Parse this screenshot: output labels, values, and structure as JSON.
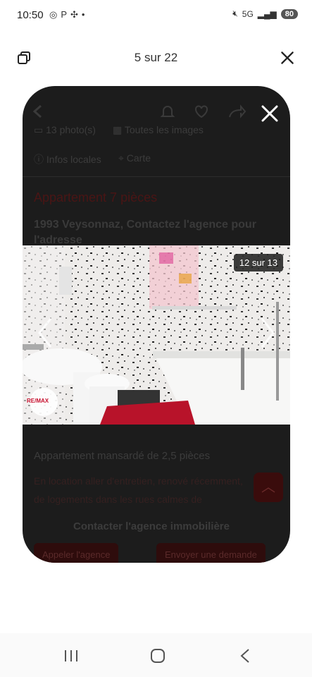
{
  "status_bar": {
    "time": "10:50",
    "left_icons": [
      "whatsapp-icon",
      "parking-icon",
      "fan-icon",
      "dot-icon"
    ],
    "network": "5G",
    "battery": "80"
  },
  "header": {
    "counter": "5 sur 22"
  },
  "listing_background": {
    "photo_count_label": "13 photo(s)",
    "all_images_label": "Toutes les images",
    "local_info_label": "Infos locales",
    "map_label": "Carte",
    "title": "Appartement 7 pièces",
    "address_line1": "1993 Veysonnaz, Contactez l'agence pour",
    "address_line2": "l'adresse",
    "similar_title": "Appartement mansardé de 2,5 pièces",
    "similar_desc_line1": "En location aller d'entretien, renové récemment,",
    "similar_desc_line2": "de logements dans les rues calmes de",
    "contact_heading": "Contacter l'agence immobilière",
    "call_button": "Appeler l'agence",
    "message_button": "Envoyer une demande"
  },
  "photo_viewer": {
    "counter": "12 sur 13",
    "logo_text": "RE/MAX"
  },
  "colors": {
    "overlay": "#1c1c1c",
    "brand_red": "#c8102e"
  }
}
